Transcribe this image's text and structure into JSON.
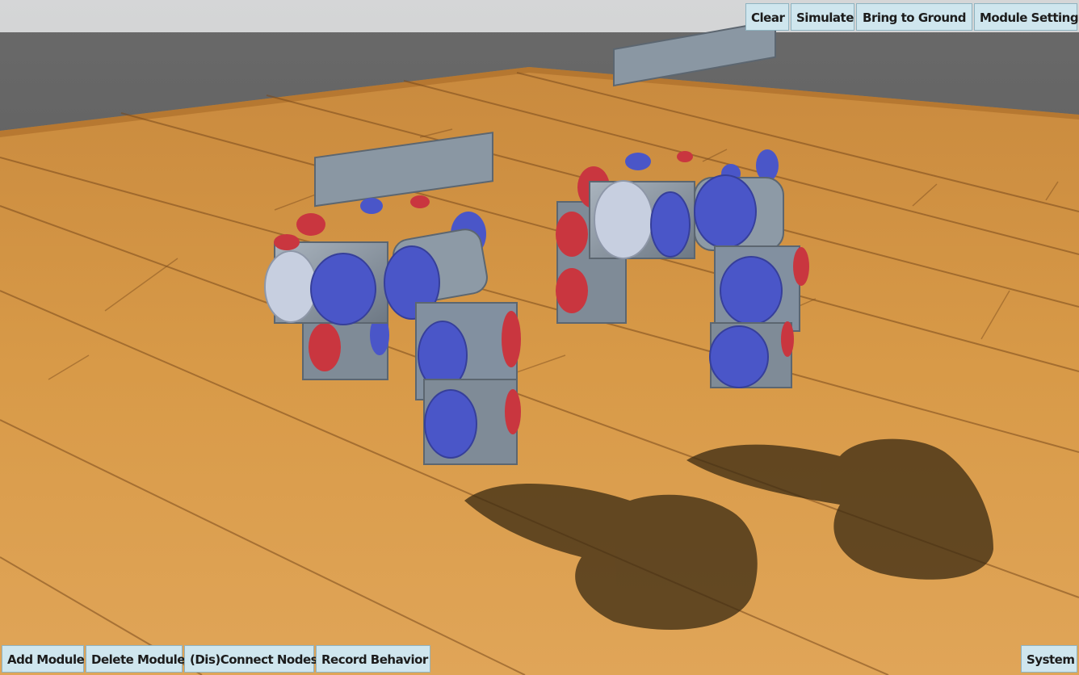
{
  "toolbar_top": {
    "clear": "Clear",
    "simulate": "Simulate",
    "bring_to_ground": "Bring to Ground",
    "module_setting": "Module Setting"
  },
  "toolbar_bottom": {
    "add_module": "Add Module",
    "delete_module": "Delete Module",
    "dis_connect_nodes": "(Dis)Connect Nodes",
    "record_behavior": "Record Behavior",
    "system": "System"
  },
  "colors": {
    "floor": "#d2913f",
    "floor_dark": "#b5722a",
    "sky": "#5d5d5d",
    "module_body": "#8d9aa6",
    "connector_blue": "#4a56c8",
    "connector_red": "#c9363f",
    "connector_white": "#c7cfe0",
    "button_bg": "#cfe6ee"
  }
}
